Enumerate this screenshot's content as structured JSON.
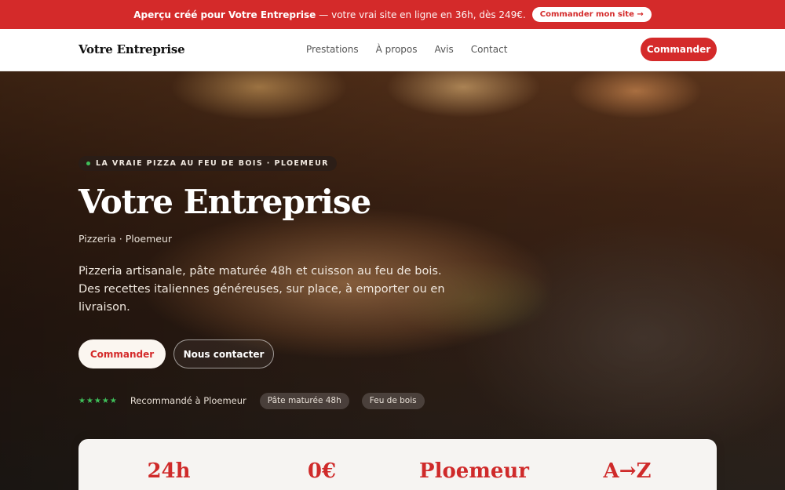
{
  "promo": {
    "bold": "Aperçu créé pour Votre Entreprise",
    "text": "— votre vrai site en ligne en 36h, dès 249€.",
    "button": "Commander mon site →"
  },
  "nav": {
    "brand": "Votre Entreprise",
    "links": [
      "Prestations",
      "À propos",
      "Avis",
      "Contact"
    ],
    "cta": "Commander"
  },
  "hero": {
    "eyebrow": "LA VRAIE PIZZA AU FEU DE BOIS · PLOEMEUR",
    "title": "Votre Entreprise",
    "subtitle": "Pizzeria · Ploemeur",
    "description": "Pizzeria artisanale, pâte maturée 48h et cuisson au feu de bois. Des recettes italiennes généreuses, sur place, à emporter ou en livraison.",
    "primary_button": "Commander",
    "secondary_button": "Nous contacter",
    "stars": "★★★★★",
    "trust_text": "Recommandé à Ploemeur",
    "chips": [
      "Pâte maturée 48h",
      "Feu de bois"
    ]
  },
  "stats": [
    "24h",
    "0€",
    "Ploemeur",
    "A→Z"
  ],
  "colors": {
    "accent": "#d42a2a",
    "star": "#3fbf5a"
  }
}
